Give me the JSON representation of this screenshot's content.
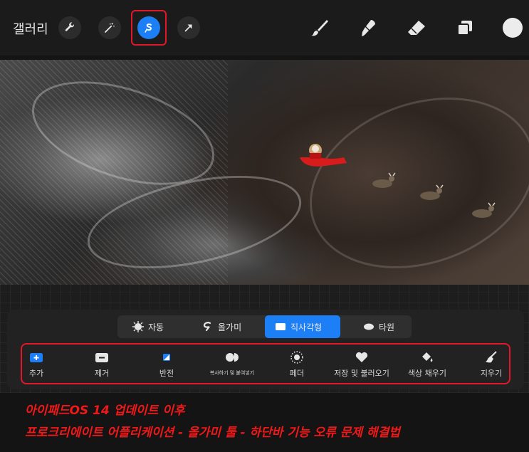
{
  "topbar": {
    "gallery_label": "갤러리",
    "left_tools": [
      {
        "icon": "wrench-icon"
      },
      {
        "icon": "magic-wand-icon"
      },
      {
        "icon": "selection-icon",
        "active": true
      },
      {
        "icon": "transform-arrow-icon"
      }
    ],
    "right_tools": [
      {
        "icon": "brush-icon"
      },
      {
        "icon": "smudge-icon"
      },
      {
        "icon": "eraser-icon"
      },
      {
        "icon": "layers-icon"
      },
      {
        "icon": "color-picker-icon",
        "color": "#ececec"
      }
    ],
    "accent_color": "#1d7ff5",
    "highlight_color": "#e3172a"
  },
  "selection_modes": [
    {
      "label": "자동",
      "icon": "auto-select-icon",
      "active": false
    },
    {
      "label": "올가미",
      "icon": "lasso-icon",
      "active": false
    },
    {
      "label": "직사각형",
      "icon": "rectangle-icon",
      "active": true
    },
    {
      "label": "타원",
      "icon": "ellipse-icon",
      "active": false
    }
  ],
  "actions": [
    {
      "label": "추가",
      "icon": "plus-icon"
    },
    {
      "label": "제거",
      "icon": "minus-icon"
    },
    {
      "label": "반전",
      "icon": "invert-icon"
    },
    {
      "label": "복사하기 및 붙여넣기",
      "icon": "copy-paste-icon"
    },
    {
      "label": "페더",
      "icon": "feather-icon"
    },
    {
      "label": "저장 및 불러오기",
      "icon": "heart-icon"
    },
    {
      "label": "색상 채우기",
      "icon": "color-fill-icon"
    },
    {
      "label": "지우기",
      "icon": "clear-broom-icon"
    }
  ],
  "caption": {
    "line1": "아이패드OS 14 업데이트 이후",
    "line2": "프로크리에이트 어플리케이션 - 올가미 툴 - 하단바 기능 오류 문제 해결법",
    "color": "#f01818"
  }
}
